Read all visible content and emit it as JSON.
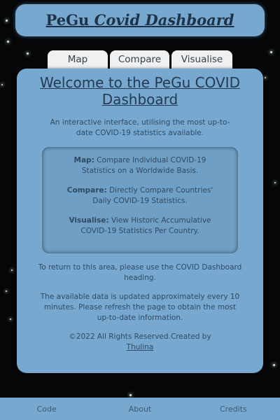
{
  "header": {
    "title_part1": "PeGu",
    "title_part2": "Covid Dashboard"
  },
  "tabs": [
    {
      "label": "Map"
    },
    {
      "label": "Compare"
    },
    {
      "label": "Visualise"
    }
  ],
  "main": {
    "heading": "Welcome to the PeGu COVID Dashboard",
    "intro": "An interactive interface, utilising the most up-to-date COVID-19 statistics available.",
    "features": [
      {
        "title": "Map:",
        "text": "Compare Individual COVID-19 Statistics on a Worldwide Basis."
      },
      {
        "title": "Compare:",
        "text": "Directly Compare Countries' Daily COVID-19 Statistics."
      },
      {
        "title": "Visualise:",
        "text": "View Historic Accumulative COVID-19 Statistics Per Country."
      }
    ],
    "return_note": "To return to this area, please use the COVID Dashboard heading.",
    "update_note": "The available data is updated approximately every 10 minutes. Please refresh the page to obtain the most up-to-date information.",
    "copyright": "©2022 All Rights Reserved.Created by",
    "author_link": "Thulina"
  },
  "footer": {
    "items": [
      "Code",
      "About",
      "Credits"
    ]
  }
}
